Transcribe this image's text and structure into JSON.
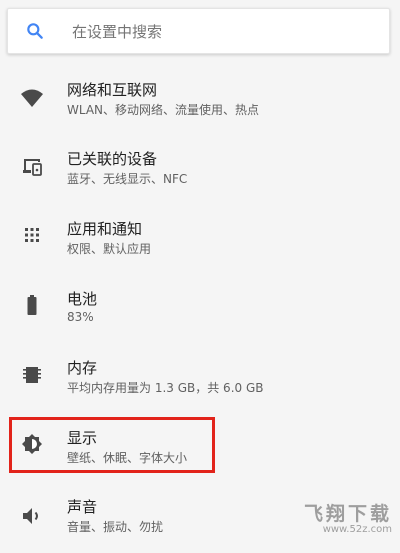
{
  "search": {
    "placeholder": "在设置中搜索",
    "icon": "search-icon"
  },
  "settings": [
    {
      "title": "网络和互联网",
      "summary": "WLAN、移动网络、流量使用、热点",
      "icon": "wifi-icon"
    },
    {
      "title": "已关联的设备",
      "summary": "蓝牙、无线显示、NFC",
      "icon": "connected-devices-icon"
    },
    {
      "title": "应用和通知",
      "summary": "权限、默认应用",
      "icon": "apps-icon"
    },
    {
      "title": "电池",
      "summary": "83%",
      "icon": "battery-icon"
    },
    {
      "title": "内存",
      "summary": "平均内存用量为 1.3 GB，共 6.0 GB",
      "icon": "memory-icon"
    },
    {
      "title": "显示",
      "summary": "壁纸、休眠、字体大小",
      "icon": "display-icon"
    },
    {
      "title": "声音",
      "summary": "音量、振动、勿扰",
      "icon": "sound-icon"
    }
  ],
  "watermark": {
    "title": "飞翔下载",
    "url": "www.52z.com"
  },
  "colors": {
    "accent": "#4285f4",
    "highlight": "#e2231a",
    "icon": "#4a4a4a"
  }
}
